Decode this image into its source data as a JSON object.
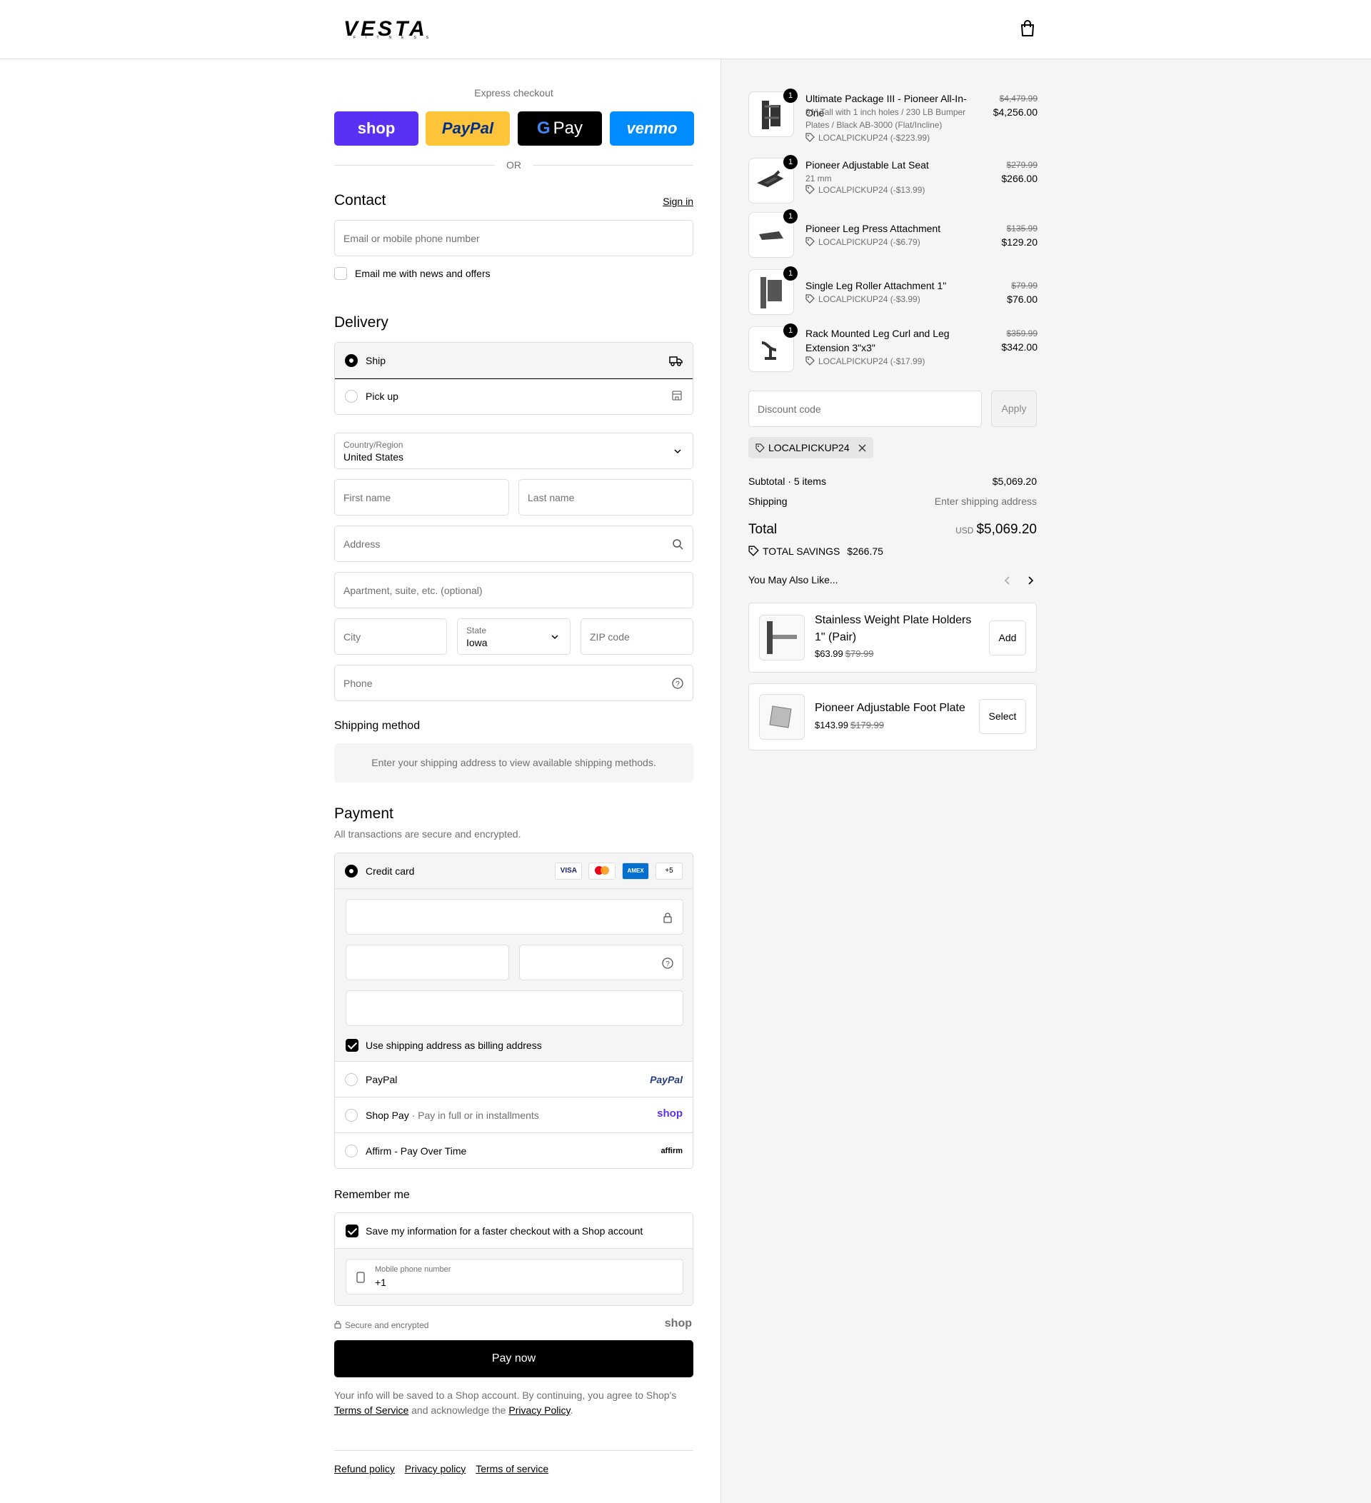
{
  "brand": {
    "name": "VESTA",
    "sub": "FITNESS"
  },
  "express": {
    "title": "Express checkout",
    "buttons": [
      "shop",
      "PayPal",
      "Pay",
      "venmo"
    ],
    "or": "OR"
  },
  "contact": {
    "title": "Contact",
    "sign_in": "Sign in",
    "email_placeholder": "Email or mobile phone number",
    "news_label": "Email me with news and offers"
  },
  "delivery": {
    "title": "Delivery",
    "options": [
      {
        "label": "Ship",
        "icon": "truck-icon",
        "selected": true
      },
      {
        "label": "Pick up",
        "icon": "store-icon",
        "selected": false
      }
    ],
    "country_label": "Country/Region",
    "country_value": "United States",
    "first_name": "First name",
    "last_name": "Last name",
    "address": "Address",
    "apartment": "Apartment, suite, etc. (optional)",
    "city": "City",
    "state_label": "State",
    "state_value": "Iowa",
    "zip": "ZIP code",
    "phone": "Phone"
  },
  "shipping_method": {
    "title": "Shipping method",
    "info": "Enter your shipping address to view available shipping methods."
  },
  "payment": {
    "title": "Payment",
    "subtitle": "All transactions are secure and encrypted.",
    "credit_card": "Credit card",
    "card_logos": [
      "VISA",
      "MC",
      "AMEX",
      "+5"
    ],
    "billing_same": "Use shipping address as billing address",
    "paypal": "PayPal",
    "paypal_logo": "PayPal",
    "shop_pay": "Shop Pay",
    "shop_pay_sub": "Pay in full or in installments",
    "shop_pay_logo": "shop",
    "affirm": "Affirm - Pay Over Time",
    "affirm_logo": "affirm"
  },
  "remember": {
    "title": "Remember me",
    "save_label": "Save my information for a faster checkout with a Shop account",
    "phone_label": "Mobile phone number",
    "phone_value": "+1",
    "secure": "Secure and encrypted",
    "shop_logo": "shop"
  },
  "pay_now": "Pay now",
  "legal": {
    "text1": "Your info will be saved to a Shop account. By continuing, you agree to Shop's",
    "terms": "Terms of Service",
    "text2": "and acknowledge the",
    "privacy": "Privacy Policy",
    "end": "."
  },
  "footer_links": [
    "Refund policy",
    "Privacy policy",
    "Terms of service"
  ],
  "order": {
    "items": [
      {
        "qty": "1",
        "name": "Ultimate Package III - Pioneer All-In-One",
        "sub": "91\" Tall with 1 inch holes / 230 LB Bumper Plates / Black AB-3000 (Flat/Incline)",
        "discount": "LOCALPICKUP24 (-$223.99)",
        "old": "$4,479.99",
        "price": "$4,256.00"
      },
      {
        "qty": "1",
        "name": "Pioneer Adjustable Lat Seat",
        "sub": "21 mm",
        "discount": "LOCALPICKUP24 (-$13.99)",
        "old": "$279.99",
        "price": "$266.00"
      },
      {
        "qty": "1",
        "name": "Pioneer Leg Press Attachment",
        "sub": "",
        "discount": "LOCALPICKUP24 (-$6.79)",
        "old": "$135.99",
        "price": "$129.20"
      },
      {
        "qty": "1",
        "name": "Single Leg Roller Attachment 1\"",
        "sub": "",
        "discount": "LOCALPICKUP24 (-$3.99)",
        "old": "$79.99",
        "price": "$76.00"
      },
      {
        "qty": "1",
        "name": "Rack Mounted Leg Curl and Leg Extension 3\"x3\"",
        "sub": "",
        "discount": "LOCALPICKUP24 (-$17.99)",
        "old": "$359.99",
        "price": "$342.00"
      }
    ],
    "discount_placeholder": "Discount code",
    "apply": "Apply",
    "applied_code": "LOCALPICKUP24",
    "subtotal_label": "Subtotal · 5 items",
    "subtotal": "$5,069.20",
    "shipping_label": "Shipping",
    "shipping_value": "Enter shipping address",
    "total_label": "Total",
    "currency": "USD",
    "total": "$5,069.20",
    "savings_label": "TOTAL SAVINGS",
    "savings": "$266.75"
  },
  "recommendations": {
    "title": "You May Also Like...",
    "items": [
      {
        "name": "Stainless Weight Plate Holders 1\" (Pair)",
        "price": "$63.99",
        "old": "$79.99",
        "button": "Add"
      },
      {
        "name": "Pioneer Adjustable Foot Plate",
        "price": "$143.99",
        "old": "$179.99",
        "button": "Select"
      }
    ]
  }
}
